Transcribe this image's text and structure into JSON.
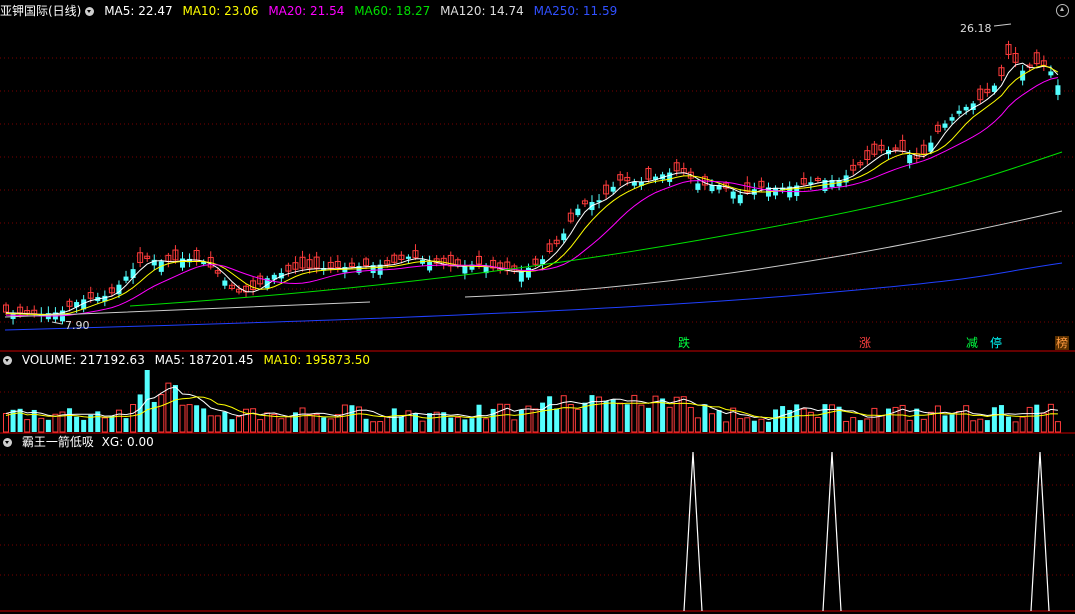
{
  "price_panel": {
    "title": "亚钾国际(日线)",
    "indicators": [
      {
        "label": "MA5: 22.47",
        "color": "#ffffff"
      },
      {
        "label": "MA10: 23.06",
        "color": "#ffff00"
      },
      {
        "label": "MA20: 21.54",
        "color": "#ff00ff"
      },
      {
        "label": "MA60: 18.27",
        "color": "#00e000"
      },
      {
        "label": "MA120: 14.74",
        "color": "#dddddd"
      },
      {
        "label": "MA250: 11.59",
        "color": "#3050ff"
      }
    ],
    "high_label": "26.18",
    "low_label": "7.90",
    "badges": [
      {
        "text": "跌",
        "color": "#00ff40"
      },
      {
        "text": "涨",
        "color": "#ff4040"
      },
      {
        "text": "减",
        "color": "#00ff40"
      },
      {
        "text": "停",
        "color": "#00ffff"
      },
      {
        "text": "榜",
        "color": "#ff9a40"
      }
    ]
  },
  "volume_panel": {
    "indicators": [
      {
        "label": "VOLUME: 217192.63",
        "color": "#ffffff"
      },
      {
        "label": "MA5: 187201.45",
        "color": "#ffffff"
      },
      {
        "label": "MA10: 195873.50",
        "color": "#ffff00"
      }
    ]
  },
  "signal_panel": {
    "indicators": [
      {
        "label": "霸王一箭低吸",
        "color": "#ffffff"
      },
      {
        "label": "XG: 0.00",
        "color": "#ffffff"
      }
    ]
  },
  "colors": {
    "up": "#ff3c3c",
    "down": "#54ffff",
    "grid": "#7a0000",
    "border": "#c80000"
  }
}
